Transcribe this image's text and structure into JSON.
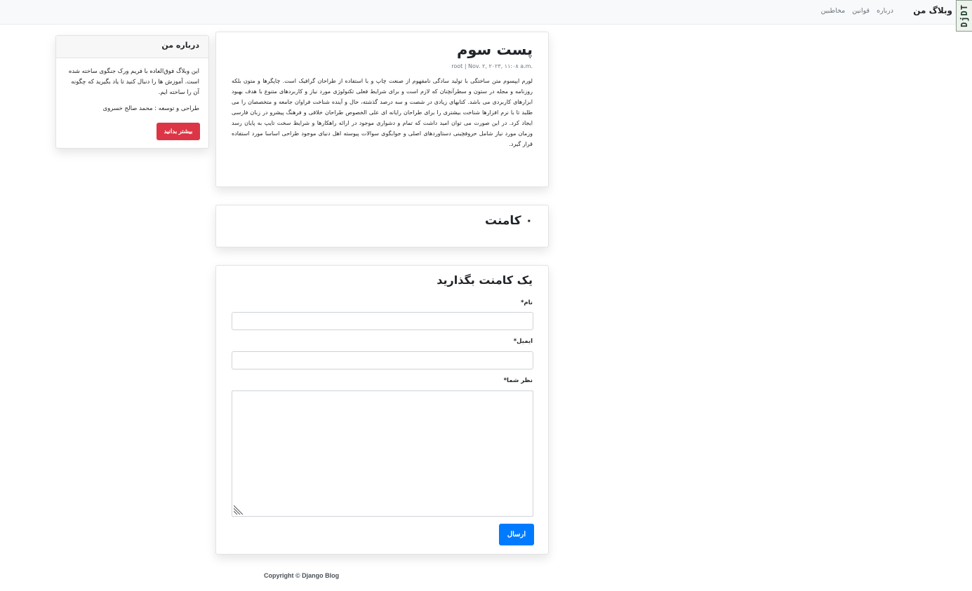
{
  "navbar": {
    "brand": "وبلاگ من",
    "links": [
      "درباره",
      "قوانین",
      "مخاطبین"
    ]
  },
  "debug_toolbar": {
    "label": "DjDT"
  },
  "sidebar": {
    "header": "درباره من",
    "text": "این وبلاگ فوق‌العاده با فریم ورک جنگوی ساخته شده است. آموزش ها را دنبال کنید تا یاد بگیرید که چگونه آن را ساخته ایم.",
    "credit": "طراحی و توسعه : محمد صالح خسروی",
    "button": "بیشتر بدانید"
  },
  "post": {
    "title": "پست سوم",
    "meta": "root | Nov. ۲, ۲۰۲۳, ۱۱:۰۸ a.m.",
    "body": "لورم ایپسوم متن ساختگی با تولید سادگی نامفهوم از صنعت چاپ و با استفاده از طراحان گرافیک است. چاپگرها و متون بلکه روزنامه و مجله در ستون و سطرآنچنان که لازم است و برای شرایط فعلی تکنولوژی مورد نیاز و کاربردهای متنوع با هدف بهبود ابزارهای کاربردی می باشد. کتابهای زیادی در شصت و سه درصد گذشته، حال و آینده شناخت فراوان جامعه و متخصصان را می طلبد تا با نرم افزارها شناخت بیشتری را برای طراحان رایانه ای علی الخصوص طراحان خلاقی و فرهنگ پیشرو در زبان فارسی ایجاد کرد. در این صورت می توان امید داشت که تمام و دشواری موجود در ارائه راهکارها و شرایط سخت تایپ به پایان رسد وزمان مورد نیاز شامل حروفچینی دستاوردهای اصلی و جوابگوی سوالات پیوسته اهل دنیای موجود طراحی اساسا مورد استفاده قرار گیرد."
  },
  "comments": {
    "title": "۰ کامنت"
  },
  "comment_form": {
    "title": "یک کامنت بگذارید",
    "name_label": "نام*",
    "email_label": "ایمیل*",
    "body_label": "نظر شما*",
    "name_value": "",
    "email_value": "",
    "body_value": "",
    "submit": "ارسال"
  },
  "footer": {
    "text": "Copyright © Django Blog"
  }
}
